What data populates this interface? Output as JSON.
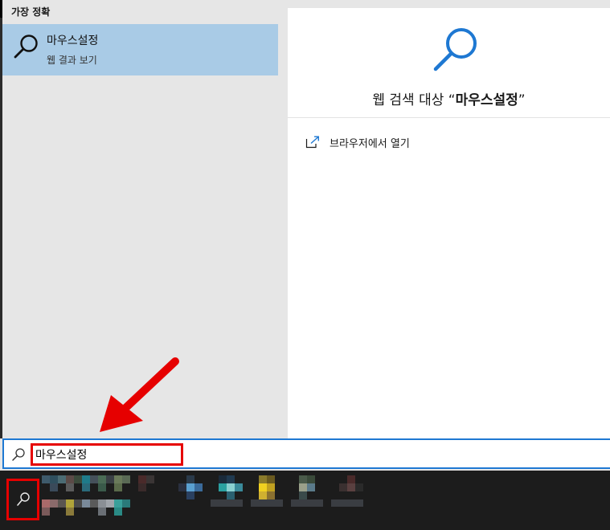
{
  "results": {
    "section_label": "가장 정확",
    "best_match": {
      "title": "마우스설정",
      "subtitle": "웹 결과 보기"
    }
  },
  "preview": {
    "title_prefix": "웹 검색 대상 “",
    "title_query": "마우스설정",
    "title_suffix": "”",
    "actions": [
      {
        "label": "브라우저에서 열기",
        "icon": "open-in-browser-icon"
      }
    ]
  },
  "search": {
    "value": "마우스설정"
  },
  "colors": {
    "accent": "#1e78d2",
    "selection": "#a9cbe6",
    "annotation": "#e60000",
    "taskbar": "#1c1c1c"
  }
}
